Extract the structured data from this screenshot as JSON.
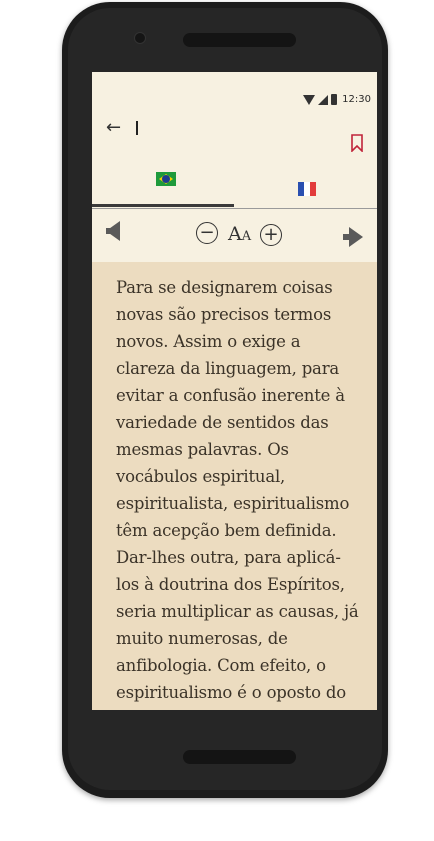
{
  "status_bar": {
    "time": "12:30"
  },
  "appbar": {
    "search_value": ""
  },
  "tabs": [
    {
      "label": "Português",
      "flag": "brazil-flag",
      "active": true
    },
    {
      "label": "Français",
      "flag": "france-flag",
      "active": false
    }
  ],
  "reader_toolbar": {
    "font_size_big": "A",
    "font_size_small": "A"
  },
  "content": {
    "paragraph": "Para se designarem coisas novas são precisos termos novos. Assim o exige a clareza da linguagem, para evitar a confusão inerente à variedade de sentidos das mesmas palavras. Os vocábulos espiritual, espiritualista, espiritualismo têm acepção bem definida. Dar-lhes outra, para aplicá-los à doutrina dos Espíritos, seria multiplicar as causas, já muito numerosas, de anfibologia. Com efeito, o espiritualismo é o oposto do materialismo. Quem quer que"
  },
  "colors": {
    "page_bg": "#f7f1e1",
    "text_bg": "#ecdcc0",
    "bookmark": "#c0243a",
    "text": "#3b3328"
  }
}
